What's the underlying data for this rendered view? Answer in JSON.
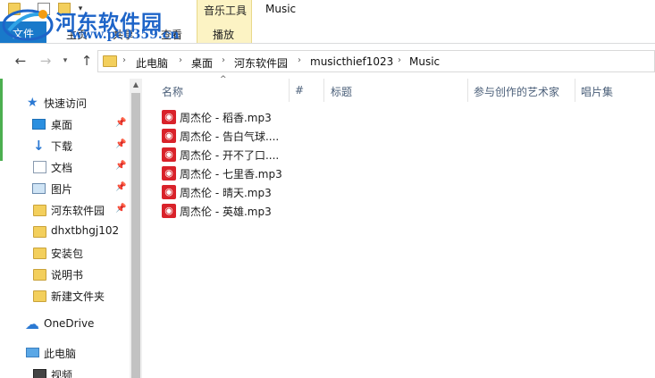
{
  "quick_access_toolbar": {
    "caret": "▾"
  },
  "contextual_tab": {
    "label": "音乐工具"
  },
  "window_title": "Music",
  "watermark": {
    "name": "河东软件园",
    "url": "www.pc0359.cn"
  },
  "ribbon_tabs": {
    "file": "文件",
    "home": "主页",
    "share": "共享",
    "view": "查看",
    "play": "播放"
  },
  "nav_buttons": {
    "back": "←",
    "forward": "→",
    "recent": "▾",
    "up": "↑"
  },
  "address_bar": {
    "separator": "›",
    "crumbs": [
      "此电脑",
      "桌面",
      "河东软件园",
      "musicthief1023",
      "Music"
    ]
  },
  "navigation_pane": {
    "quick_access": "快速访问",
    "pin_glyph": "📌",
    "items": [
      {
        "label": "桌面",
        "pinned": true
      },
      {
        "label": "下载",
        "pinned": true
      },
      {
        "label": "文档",
        "pinned": true
      },
      {
        "label": "图片",
        "pinned": true
      },
      {
        "label": "河东软件园",
        "pinned": true
      },
      {
        "label": "dhxtbhgj102",
        "pinned": false
      },
      {
        "label": "安装包",
        "pinned": false
      },
      {
        "label": "说明书",
        "pinned": false
      },
      {
        "label": "新建文件夹",
        "pinned": false
      }
    ],
    "onedrive": "OneDrive",
    "this_pc": "此电脑",
    "videos": "视频"
  },
  "scrollbar": {
    "up_arrow": "▲"
  },
  "file_list": {
    "sort_indicator": "^",
    "columns": {
      "name": "名称",
      "number": "#",
      "title": "标题",
      "artists": "参与创作的艺术家",
      "album": "唱片集"
    },
    "icon_glyph": "◉",
    "files": [
      "周杰伦 - 稻香.mp3",
      "周杰伦 - 告白气球....",
      "周杰伦 - 开不了口....",
      "周杰伦 - 七里香.mp3",
      "周杰伦 - 晴天.mp3",
      "周杰伦 - 英雄.mp3"
    ]
  },
  "colors": {
    "file_tab": "#1979ca",
    "contextual_tab_bg": "#fcf3c4",
    "watermark": "#1d64c8",
    "netease_icon": "#d9222a",
    "column_header_text": "#4c607a"
  }
}
